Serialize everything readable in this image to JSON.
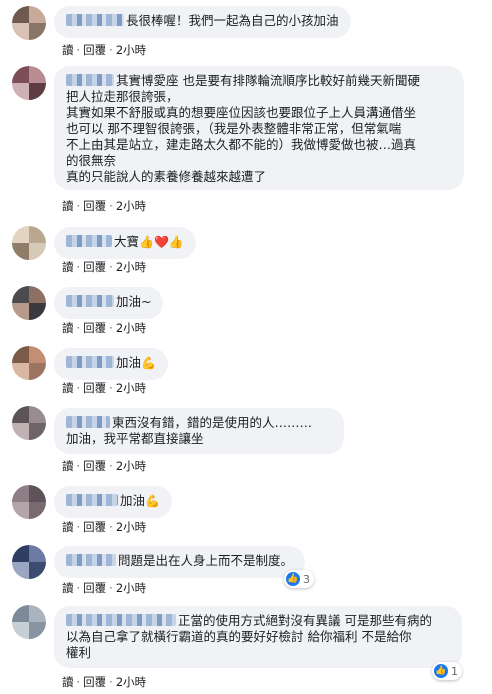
{
  "actions": {
    "read": "讀",
    "reply": "回覆"
  },
  "comments": [
    {
      "text": "長很棒喔！我們一起為自己的小孩加油",
      "time": "2小時"
    },
    {
      "lines": [
        "其實博愛座 也是要有排隊輪流順序比較好前幾天新聞硬",
        "把人拉走那很誇張，",
        "其實如果不舒服或真的想要座位因該也要跟位子上人員溝通借坐",
        "也可以 那不理智很誇張，（我是外表整體非常正常，但常氣喘",
        "不上由其是站立，建走路太久都不能的）我做博愛做也被…過真",
        "的很無奈",
        "真的只能說人的素養修養越來越遭了"
      ],
      "time": "2小時"
    },
    {
      "text": "大寶",
      "emojis": "👍❤️👍",
      "time": "2小時"
    },
    {
      "text": "加油~",
      "time": "2小時"
    },
    {
      "text": "加油",
      "emojis": "💪",
      "time": "2小時"
    },
    {
      "lines": [
        "東西沒有錯，錯的是使用的人………",
        "加油，我平常都直接讓坐"
      ],
      "time": "2小時"
    },
    {
      "text": "加油",
      "emojis": "💪",
      "time": "2小時"
    },
    {
      "text": "問題是出在人身上而不是制度。",
      "time": "2小時",
      "reactions": "3"
    },
    {
      "lines": [
        "正當的使用方式絕對沒有異議 可是那些有病的",
        "以為自己拿了就橫行霸道的真的要好好檢討 給你福利 不是給你",
        "權利"
      ],
      "time": "2小時",
      "reactions": "1"
    }
  ]
}
